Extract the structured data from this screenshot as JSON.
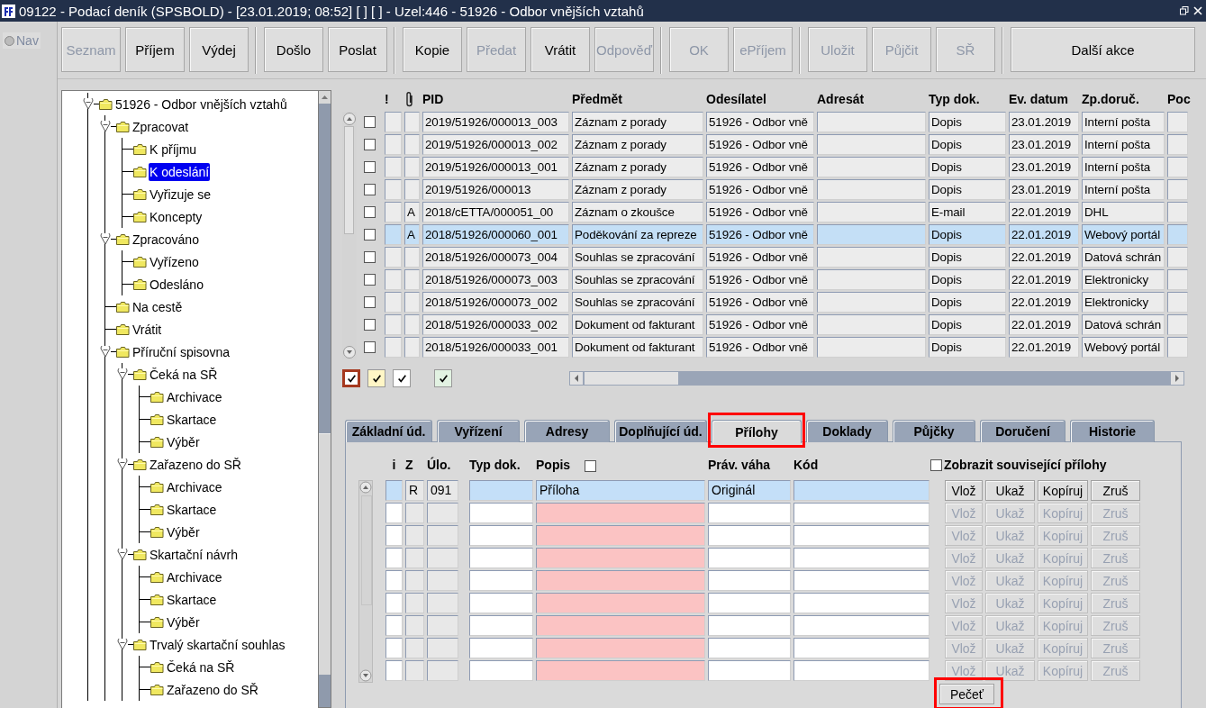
{
  "window": {
    "title": "09122 - Podací deník (SPSBOLD) - [23.01.2019; 08:52] [ ] [ ] - Uzel:446 - 51926 - Odbor vnějších vztahů"
  },
  "nav": {
    "label": "Nav",
    "selected": false
  },
  "toolbar": {
    "groups": [
      [
        {
          "label": "Seznam",
          "disabled": true
        },
        {
          "label": "Příjem",
          "disabled": false
        },
        {
          "label": "Výdej",
          "disabled": false
        }
      ],
      [
        {
          "label": "Došlo",
          "disabled": false
        },
        {
          "label": "Poslat",
          "disabled": false
        }
      ],
      [
        {
          "label": "Kopie",
          "disabled": false
        },
        {
          "label": "Předat",
          "disabled": true
        },
        {
          "label": "Vrátit",
          "disabled": false
        },
        {
          "label": "Odpověď",
          "disabled": true
        }
      ],
      [
        {
          "label": "OK",
          "disabled": true
        },
        {
          "label": "ePříjem",
          "disabled": true
        }
      ],
      [
        {
          "label": "Uložit",
          "disabled": true
        },
        {
          "label": "Půjčit",
          "disabled": true
        },
        {
          "label": "SŘ",
          "disabled": true
        }
      ],
      [
        {
          "label": "Další akce",
          "disabled": false
        }
      ]
    ]
  },
  "tree": {
    "items": [
      {
        "label": "51926 - Odbor vnějších vztahů",
        "expanded": true,
        "selected": false,
        "children": [
          {
            "label": "Zpracovat",
            "expanded": true,
            "selected": false,
            "children": [
              {
                "label": "K příjmu",
                "selected": false
              },
              {
                "label": "K odeslání",
                "selected": true
              },
              {
                "label": "Vyřizuje se",
                "selected": false
              },
              {
                "label": "Koncepty",
                "selected": false
              }
            ]
          },
          {
            "label": "Zpracováno",
            "expanded": true,
            "selected": false,
            "children": [
              {
                "label": "Vyřízeno",
                "selected": false
              },
              {
                "label": "Odesláno",
                "selected": false
              }
            ]
          },
          {
            "label": "Na cestě",
            "selected": false
          },
          {
            "label": "Vrátit",
            "selected": false
          },
          {
            "label": "Příruční spisovna",
            "expanded": true,
            "selected": false,
            "children": [
              {
                "label": "Čeká na SŘ",
                "expanded": true,
                "selected": false,
                "children": [
                  {
                    "label": "Archivace",
                    "selected": false
                  },
                  {
                    "label": "Skartace",
                    "selected": false
                  },
                  {
                    "label": "Výběr",
                    "selected": false
                  }
                ]
              },
              {
                "label": "Zařazeno do SŘ",
                "expanded": true,
                "selected": false,
                "children": [
                  {
                    "label": "Archivace",
                    "selected": false
                  },
                  {
                    "label": "Skartace",
                    "selected": false
                  },
                  {
                    "label": "Výběr",
                    "selected": false
                  }
                ]
              },
              {
                "label": "Skartační návrh",
                "expanded": true,
                "selected": false,
                "children": [
                  {
                    "label": "Archivace",
                    "selected": false
                  },
                  {
                    "label": "Skartace",
                    "selected": false
                  },
                  {
                    "label": "Výběr",
                    "selected": false
                  }
                ]
              },
              {
                "label": "Trvalý skartační souhlas",
                "expanded": true,
                "selected": false,
                "children": [
                  {
                    "label": "Čeká na SŘ",
                    "selected": false
                  },
                  {
                    "label": "Zařazeno do SŘ",
                    "selected": false
                  }
                ]
              }
            ]
          }
        ]
      }
    ]
  },
  "documents": {
    "columns": [
      "!",
      "PID",
      "Předmět",
      "Odesílatel",
      "Adresát",
      "Typ dok.",
      "Ev. datum",
      "Zp.doruč.",
      "Poc"
    ],
    "rows": [
      {
        "checked": false,
        "selected": false,
        "pid": "2019/51926/000013_003",
        "subject": "Záznam z porady",
        "sender": "51926 - Odbor vně",
        "doc_type": "Dopis",
        "date": "23.01.2019",
        "delivery": "Interní pošta"
      },
      {
        "checked": false,
        "selected": false,
        "pid": "2019/51926/000013_002",
        "subject": "Záznam z porady",
        "sender": "51926 - Odbor vně",
        "doc_type": "Dopis",
        "date": "23.01.2019",
        "delivery": "Interní pošta"
      },
      {
        "checked": false,
        "selected": false,
        "pid": "2019/51926/000013_001",
        "subject": "Záznam z porady",
        "sender": "51926 - Odbor vně",
        "doc_type": "Dopis",
        "date": "23.01.2019",
        "delivery": "Interní pošta"
      },
      {
        "checked": false,
        "selected": false,
        "pid": "2019/51926/000013",
        "subject": "Záznam z porady",
        "sender": "51926 - Odbor vně",
        "doc_type": "Dopis",
        "date": "23.01.2019",
        "delivery": "Interní pošta"
      },
      {
        "checked": false,
        "selected": false,
        "attachment": "A",
        "pid": "2018/cETTA/000051_00",
        "subject": "Záznam o zkoušce",
        "sender": "51926 - Odbor vně",
        "doc_type": "E-mail",
        "date": "22.01.2019",
        "delivery": "DHL"
      },
      {
        "checked": false,
        "selected": true,
        "attachment": "A",
        "pid": "2018/51926/000060_001",
        "subject": "Poděkování za repreze",
        "sender": "51926 - Odbor vně",
        "doc_type": "Dopis",
        "date": "22.01.2019",
        "delivery": "Webový portál"
      },
      {
        "checked": false,
        "selected": false,
        "pid": "2018/51926/000073_004",
        "subject": "Souhlas se zpracování",
        "sender": "51926 - Odbor vně",
        "doc_type": "Dopis",
        "date": "22.01.2019",
        "delivery": "Datová schrán"
      },
      {
        "checked": false,
        "selected": false,
        "pid": "2018/51926/000073_003",
        "subject": "Souhlas se zpracování",
        "sender": "51926 - Odbor vně",
        "doc_type": "Dopis",
        "date": "22.01.2019",
        "delivery": "Elektronicky"
      },
      {
        "checked": false,
        "selected": false,
        "pid": "2018/51926/000073_002",
        "subject": "Souhlas se zpracování",
        "sender": "51926 - Odbor vně",
        "doc_type": "Dopis",
        "date": "22.01.2019",
        "delivery": "Elektronicky"
      },
      {
        "checked": false,
        "selected": false,
        "pid": "2018/51926/000033_002",
        "subject": "Dokument od fakturant",
        "sender": "51926 - Odbor vně",
        "doc_type": "Dopis",
        "date": "22.01.2019",
        "delivery": "Datová schrán"
      },
      {
        "checked": false,
        "selected": false,
        "pid": "2018/51926/000033_001",
        "subject": "Dokument od fakturant",
        "sender": "51926 - Odbor vně",
        "doc_type": "Dopis",
        "date": "22.01.2019",
        "delivery": "Webový portál"
      }
    ]
  },
  "legend": [
    {
      "color": "#ffffff",
      "checked": true,
      "selected": true
    },
    {
      "color": "#fff6c6",
      "checked": true,
      "selected": false
    },
    {
      "color": "#ffffff",
      "checked": true,
      "selected": false
    },
    {
      "color": "#e2f2e2",
      "checked": true,
      "selected": false
    }
  ],
  "tabs": [
    {
      "label": "Základní úd.",
      "selected": false,
      "annotated": false
    },
    {
      "label": "Vyřízení",
      "selected": false,
      "annotated": false
    },
    {
      "label": "Adresy",
      "selected": false,
      "annotated": false
    },
    {
      "label": "Doplňující úd.",
      "selected": false,
      "annotated": false
    },
    {
      "label": "Přílohy",
      "selected": true,
      "annotated": true
    },
    {
      "label": "Doklady",
      "selected": false,
      "annotated": false
    },
    {
      "label": "Půjčky",
      "selected": false,
      "annotated": false
    },
    {
      "label": "Doručení",
      "selected": false,
      "annotated": false
    },
    {
      "label": "Historie",
      "selected": false,
      "annotated": false
    }
  ],
  "attachments": {
    "columns": [
      "i",
      "Z",
      "Úlo.",
      "Typ dok.",
      "Popis",
      "Práv. váha",
      "Kód"
    ],
    "description_checkbox": {
      "checked": false
    },
    "show_related": {
      "label": "Zobrazit související přílohy",
      "checked": false
    },
    "rows": [
      {
        "selected": true,
        "z": "R",
        "task": "091",
        "description": "Příloha",
        "legal_weight": "Originál",
        "actions": [
          {
            "label": "Vlož",
            "disabled": false
          },
          {
            "label": "Ukaž",
            "disabled": false
          },
          {
            "label": "Kopíruj",
            "disabled": false
          },
          {
            "label": "Zruš",
            "disabled": false
          }
        ]
      },
      {
        "selected": false,
        "actions": [
          {
            "label": "Vlož",
            "disabled": true
          },
          {
            "label": "Ukaž",
            "disabled": true
          },
          {
            "label": "Kopíruj",
            "disabled": true
          },
          {
            "label": "Zruš",
            "disabled": true
          }
        ]
      },
      {
        "selected": false,
        "actions": [
          {
            "label": "Vlož",
            "disabled": true
          },
          {
            "label": "Ukaž",
            "disabled": true
          },
          {
            "label": "Kopíruj",
            "disabled": true
          },
          {
            "label": "Zruš",
            "disabled": true
          }
        ]
      },
      {
        "selected": false,
        "actions": [
          {
            "label": "Vlož",
            "disabled": true
          },
          {
            "label": "Ukaž",
            "disabled": true
          },
          {
            "label": "Kopíruj",
            "disabled": true
          },
          {
            "label": "Zruš",
            "disabled": true
          }
        ]
      },
      {
        "selected": false,
        "actions": [
          {
            "label": "Vlož",
            "disabled": true
          },
          {
            "label": "Ukaž",
            "disabled": true
          },
          {
            "label": "Kopíruj",
            "disabled": true
          },
          {
            "label": "Zruš",
            "disabled": true
          }
        ]
      },
      {
        "selected": false,
        "actions": [
          {
            "label": "Vlož",
            "disabled": true
          },
          {
            "label": "Ukaž",
            "disabled": true
          },
          {
            "label": "Kopíruj",
            "disabled": true
          },
          {
            "label": "Zruš",
            "disabled": true
          }
        ]
      },
      {
        "selected": false,
        "actions": [
          {
            "label": "Vlož",
            "disabled": true
          },
          {
            "label": "Ukaž",
            "disabled": true
          },
          {
            "label": "Kopíruj",
            "disabled": true
          },
          {
            "label": "Zruš",
            "disabled": true
          }
        ]
      },
      {
        "selected": false,
        "actions": [
          {
            "label": "Vlož",
            "disabled": true
          },
          {
            "label": "Ukaž",
            "disabled": true
          },
          {
            "label": "Kopíruj",
            "disabled": true
          },
          {
            "label": "Zruš",
            "disabled": true
          }
        ]
      },
      {
        "selected": false,
        "actions": [
          {
            "label": "Vlož",
            "disabled": true
          },
          {
            "label": "Ukaž",
            "disabled": true
          },
          {
            "label": "Kopíruj",
            "disabled": true
          },
          {
            "label": "Zruš",
            "disabled": true
          }
        ]
      }
    ],
    "seal_button": {
      "label": "Pečeť",
      "annotated": true
    }
  }
}
